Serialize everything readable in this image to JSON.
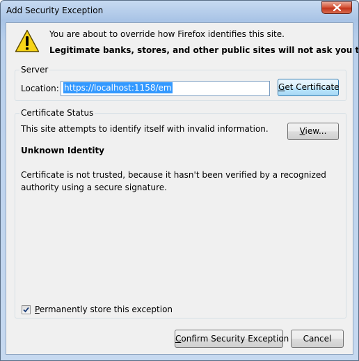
{
  "window": {
    "title": "Add Security Exception",
    "close_label": "Close"
  },
  "header": {
    "intro": "You are about to override how Firefox identifies this site.",
    "warning": "Legitimate banks, stores, and other public sites will not ask you to do this."
  },
  "server": {
    "group_label": "Server",
    "location_label": "Location:",
    "location_value": "https://localhost:1158/em",
    "get_certificate_access_key": "G",
    "get_certificate_rest": "et Certificate"
  },
  "certificate_status": {
    "group_label": "Certificate Status",
    "summary": "This site attempts to identify itself with invalid information.",
    "view_access_key": "V",
    "view_rest": "iew...",
    "identity_heading": "Unknown Identity",
    "details": "Certificate is not trusted, because it hasn't been verified by a recognized authority using a secure signature."
  },
  "options": {
    "store_access_key": "P",
    "store_rest": "ermanently store this exception",
    "store_checked": true
  },
  "buttons": {
    "confirm_access_key": "C",
    "confirm_rest": "onfirm Security Exception",
    "cancel_label": "Cancel"
  },
  "icons": {
    "warning": "warning-triangle-icon",
    "close": "close-icon",
    "check": "checkmark-icon"
  },
  "colors": {
    "selection": "#3399ff",
    "warning_fill": "#f7d417",
    "close_button": "#c7391d"
  }
}
